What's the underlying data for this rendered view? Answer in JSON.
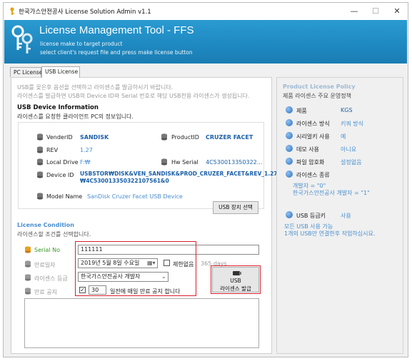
{
  "window": {
    "title": "한국가스안전공사 License Solution Admin v1.1",
    "controls": {
      "minimize": "—",
      "maximize": "☐",
      "close": "✕"
    }
  },
  "banner": {
    "title": "License Management Tool - FFS",
    "sub1": "license make to target product",
    "sub2": "select client's request file and press make license button"
  },
  "tabs": [
    {
      "label": "PC License"
    },
    {
      "label": "USB License"
    }
  ],
  "usb": {
    "intro1": "USB를 꽂은후 옵션을 선택하고 라이센스를 발급하시기 바랍니다.",
    "intro2": "라이센스를 발급하면 USB의 Device ID와 Serial 번호로 해당 USB전용 라이센스가 생성됩니다.",
    "device_title": "USB Device Information",
    "device_sub": "라이센스를 요청한 클라이언트 PC의 정보입니다.",
    "fields": {
      "vender_label": "VenderID",
      "vender_value": "SANDISK",
      "product_label": "ProductID",
      "product_value": "CRUZER  FACET",
      "rev_label": "REV",
      "rev_value": "1.27",
      "drive_label": "Local Drive",
      "drive_value": "F:₩",
      "hw_label": "Hw Serial",
      "hw_value": "4C530013350322...",
      "device_label": "Device ID",
      "device_value1": "USBSTOR₩DISK&VEN_SANDISK&PROD_CRUZER_FACET&REV_1.27",
      "device_value2": "₩4C530013350322107561&0",
      "model_label": "Model Name",
      "model_value": "SanDisk Cruzer Facet USB Device"
    },
    "select_button": "USB 장치 선택",
    "condition_title": "License Condition",
    "condition_sub": "라이센스할 조건를 선택합니다.",
    "serial_label": "Serial No",
    "serial_value": "111111",
    "expire_label": "만료일자",
    "expire_value": "2019년  5월  8일 수요일",
    "unlimited_label": "제한없음",
    "days_label": "365 days",
    "grade_label": "라이센스 등급",
    "grade_value": "한국가스안전공사 개발자",
    "notice_label": "만료 공지",
    "notice_days": "30",
    "notice_text": "일전에 매일 만료 공지 합니다",
    "issue_button_line1": "USB",
    "issue_button_line2": "라이센스 발급"
  },
  "policy": {
    "title": "Product License Policy",
    "sub": "제품 라이센스 주요 운영정책",
    "items": [
      {
        "label": "제품",
        "value": "KGS"
      },
      {
        "label": "라이센스 방식",
        "value": "키쿼 방식"
      },
      {
        "label": "시리얼키 사용",
        "value": "예"
      },
      {
        "label": "데모 사용",
        "value": "아니요"
      },
      {
        "label": "파일 암호화",
        "value": "설정없음"
      },
      {
        "label": "라이센스 종류",
        "value": ""
      }
    ],
    "kind_note1": "개발자 = \"0\"",
    "kind_note2": "한국가스안전공사 개발자 = \"1\"",
    "usb_label": "USB 등급키",
    "usb_value": "사용",
    "usb_note1": "모든 USB 사용 가능",
    "usb_note2": "1개의 USB만 연결한후 작업하십시요."
  }
}
